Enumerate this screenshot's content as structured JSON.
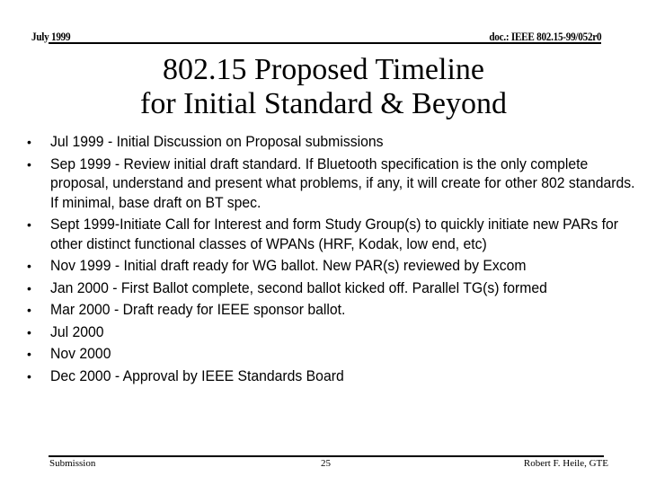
{
  "header": {
    "date": "July 1999",
    "doc_id": "doc.: IEEE 802.15-99/052r0"
  },
  "title": {
    "line1": "802.15 Proposed Timeline",
    "line2": "for Initial Standard & Beyond"
  },
  "bullets": [
    {
      "bullet_icon": "bullet-dot",
      "text": "Jul 1999 - Initial Discussion on Proposal submissions"
    },
    {
      "bullet_icon": "bullet-dot",
      "text": "Sep 1999 - Review initial  draft standard. If  Bluetooth specification is the only complete proposal, understand and present what problems, if any,  it will create for other 802 standards. If minimal, base draft on BT spec."
    },
    {
      "bullet_icon": "bullet-dot",
      "text": "Sept 1999-Initiate Call for Interest and form Study Group(s) to quickly initiate new PARs for other distinct functional classes of WPANs (HRF, Kodak, low end, etc)"
    },
    {
      "bullet_icon": "bullet-dot",
      "text": "Nov 1999 - Initial draft ready for WG ballot. New PAR(s) reviewed by Excom"
    },
    {
      "bullet_icon": "bullet-dot",
      "text": "Jan 2000 - First Ballot complete, second ballot kicked off. Parallel TG(s) formed"
    },
    {
      "bullet_icon": "bullet-dot",
      "text": "Mar 2000 - Draft ready for IEEE sponsor ballot."
    },
    {
      "bullet_icon": "bullet-dot",
      "text": "Jul 2000"
    },
    {
      "bullet_icon": "bullet-dot",
      "text": "Nov 2000"
    },
    {
      "bullet_icon": "bullet-dot",
      "text": "Dec 2000 - Approval by IEEE Standards Board"
    }
  ],
  "footer": {
    "label": "Submission",
    "page_number": "25",
    "author": "Robert F. Heile, GTE"
  },
  "bullet_glyph": "•"
}
